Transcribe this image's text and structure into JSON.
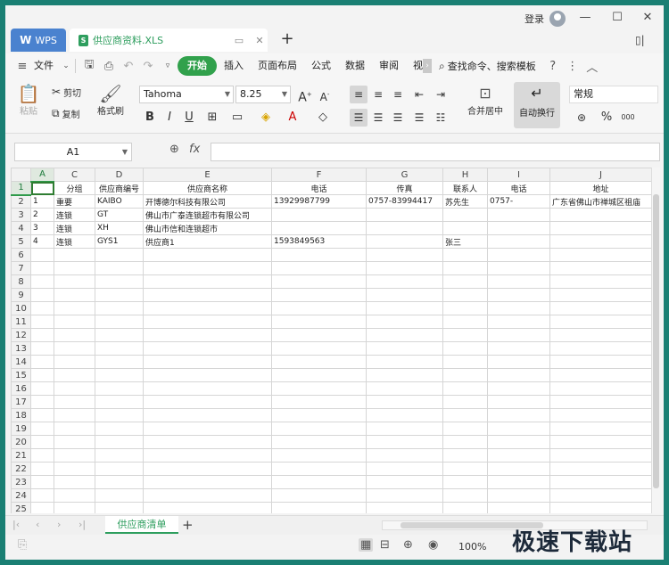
{
  "titlebar": {
    "wps_tab": "WPS",
    "file_tab": "供应商资料.XLS",
    "new_tab": "+",
    "login": "登录",
    "minimize": "—",
    "maximize": "☐",
    "close": "✕"
  },
  "menu": {
    "file": "文件",
    "items": [
      "开始",
      "插入",
      "页面布局",
      "公式",
      "数据",
      "审阅",
      "视"
    ],
    "search": "查找命令、搜索模板"
  },
  "ribbon": {
    "paste": "粘贴",
    "cut": "剪切",
    "copy": "复制",
    "format_painter": "格式刷",
    "font_name": "Tahoma",
    "font_size": "8.25",
    "merge_center": "合并居中",
    "wrap_text": "自动换行",
    "number_format": "常规",
    "percent": "%",
    "decimals": "000"
  },
  "formula_bar": {
    "cell_ref": "A1",
    "fx": "fx",
    "value": ""
  },
  "sheet": {
    "columns": [
      "A",
      "C",
      "D",
      "E",
      "F",
      "G",
      "H",
      "I",
      "J"
    ],
    "row_numbers": [
      "1",
      "2",
      "3",
      "4",
      "5",
      "6",
      "7",
      "8",
      "9",
      "10",
      "11",
      "12",
      "13",
      "14",
      "15",
      "16",
      "17",
      "18",
      "19",
      "20",
      "21",
      "22",
      "23",
      "24",
      "25"
    ],
    "header_row": [
      "",
      "分组",
      "供应商编号",
      "供应商名称",
      "电话",
      "传真",
      "联系人",
      "电话",
      "地址"
    ],
    "rows": [
      [
        "1",
        "重要",
        "KAIBO",
        "开博德尔科技有限公司",
        "13929987799",
        "0757-83994417",
        "苏先生",
        "0757-",
        "广东省佛山市禅城区祖庙"
      ],
      [
        "2",
        "连锁",
        "GT",
        "佛山市广泰连锁超市有限公司",
        "",
        "",
        "",
        "",
        ""
      ],
      [
        "3",
        "连锁",
        "XH",
        "佛山市信和连锁超市",
        "",
        "",
        "",
        "",
        ""
      ],
      [
        "4",
        "连锁",
        "GYS1",
        "供应商1",
        "1593849563",
        "",
        "张三",
        "",
        ""
      ]
    ]
  },
  "sheet_tabs": {
    "active": "供应商清单",
    "add": "+"
  },
  "status": {
    "zoom": "100%"
  },
  "watermark": "极速下载站"
}
